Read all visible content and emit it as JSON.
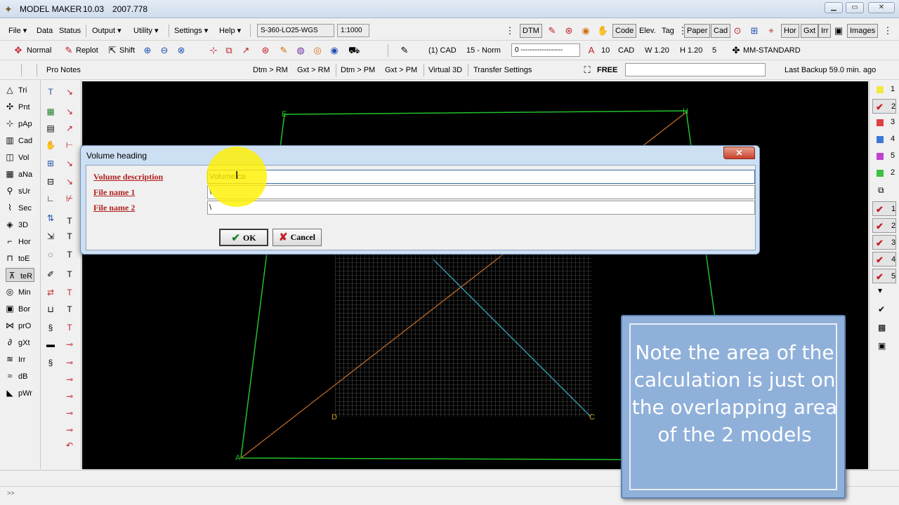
{
  "titlebar": {
    "app_name": "MODEL MAKER",
    "version": "10.03",
    "build": "2007.778",
    "min_icon": "minimize-icon",
    "max_icon": "maximize-icon",
    "close_icon": "close-icon"
  },
  "menu": {
    "file": "File",
    "data": "Data",
    "status": "Status",
    "output": "Output",
    "utility": "Utility",
    "settings": "Settings",
    "help": "Help",
    "project_code": "S-360-LO25-WGS",
    "scale": "1:1000",
    "dtm": "DTM",
    "code": "Code",
    "elev": "Elev.",
    "tag": "Tag",
    "paper": "Paper",
    "cad": "Cad",
    "hor": "Hor",
    "gxt": "Gxt",
    "lrr": "Irr",
    "images": "Images"
  },
  "toolbar2": {
    "normal": "Normal",
    "replot": "Replot",
    "shift": "Shift",
    "layer": "(1) CAD",
    "line_style": "15 - Norm",
    "line_pattern": "0 ------------------",
    "text_size": "10",
    "text_layer": "CAD",
    "width": "W 1.20",
    "height": "H 1.20",
    "num": "5",
    "font_style": "MM-STANDARD"
  },
  "toolbar3": {
    "pro_notes": "Pro Notes",
    "dtm_rm": "Dtm > RM",
    "gxt_rm": "Gxt > RM",
    "dtm_pm": "Dtm > PM",
    "gxt_pm": "Gxt > PM",
    "virtual_3d": "Virtual 3D",
    "transfer_settings": "Transfer Settings",
    "free": "FREE",
    "last_backup": "Last Backup 59.0 min. ago"
  },
  "left_tools": [
    {
      "label": "Tri",
      "icon": "triangle-icon"
    },
    {
      "label": "Pnt",
      "icon": "point-icon"
    },
    {
      "label": "pAp",
      "icon": "point-append-icon"
    },
    {
      "label": "Cad",
      "icon": "cad-icon"
    },
    {
      "label": "Vol",
      "icon": "volume-icon"
    },
    {
      "label": "aNa",
      "icon": "analysis-icon"
    },
    {
      "label": "sUr",
      "icon": "survey-icon"
    },
    {
      "label": "Sec",
      "icon": "section-icon"
    },
    {
      "label": "3D",
      "icon": "3d-icon"
    },
    {
      "label": "Hor",
      "icon": "horizontal-icon"
    },
    {
      "label": "toE",
      "icon": "toe-icon"
    },
    {
      "label": "teR",
      "icon": "terrain-icon"
    },
    {
      "label": "Min",
      "icon": "mine-icon"
    },
    {
      "label": "Bor",
      "icon": "border-icon"
    },
    {
      "label": "prO",
      "icon": "profile-icon"
    },
    {
      "label": "gXt",
      "icon": "gxt-icon"
    },
    {
      "label": "Irr",
      "icon": "irrigation-icon"
    },
    {
      "label": "dB",
      "icon": "database-icon"
    },
    {
      "label": "pWr",
      "icon": "power-icon"
    }
  ],
  "right_layers": [
    {
      "num": "1",
      "color": "#f2e640",
      "checked": false
    },
    {
      "num": "2",
      "color": "#f2e640",
      "checked": true
    },
    {
      "num": "3",
      "color": "#e04040",
      "checked": false
    },
    {
      "num": "4",
      "color": "#3a78d8",
      "checked": false
    },
    {
      "num": "5",
      "color": "#c040d0",
      "checked": false
    },
    {
      "num": "2",
      "color": "#40c040",
      "checked": false
    },
    {
      "num": "1",
      "checked": true
    },
    {
      "num": "2",
      "checked": true
    },
    {
      "num": "3",
      "checked": true
    },
    {
      "num": "4",
      "checked": true
    },
    {
      "num": "5",
      "checked": true
    }
  ],
  "canvas": {
    "label_e": "E",
    "label_h": "H",
    "label_d": "D",
    "label_c": "C",
    "label_a": "A",
    "colors": {
      "boundary": "#22c22a",
      "diag1": "#c8702a",
      "diag2": "#38b0c8",
      "grid": "#9a9a9a"
    }
  },
  "dialog": {
    "title": "Volume heading",
    "close_icon": "close-icon",
    "fields": [
      {
        "label": "Volume description",
        "value": "Volume ca"
      },
      {
        "label": "File name 1",
        "value": "\\"
      },
      {
        "label": "File name 2",
        "value": "\\"
      }
    ],
    "ok_label": "OK",
    "cancel_label": "Cancel"
  },
  "callout": {
    "text": "Note the area of the calculation is just on the overlapping area of the 2 models"
  }
}
